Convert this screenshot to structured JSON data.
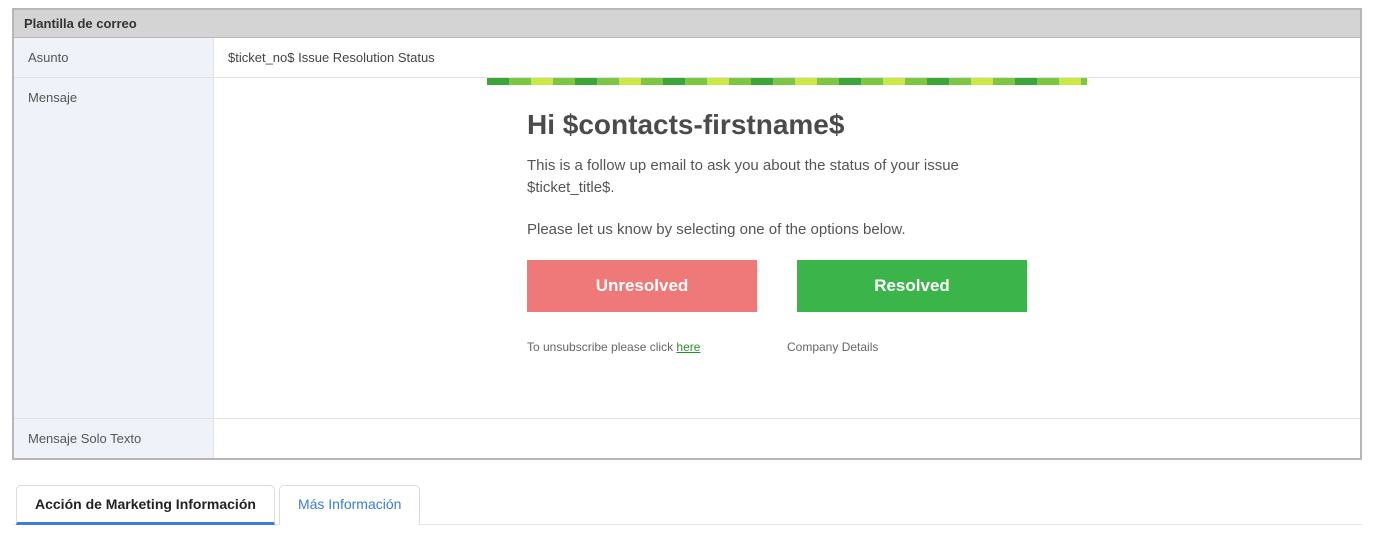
{
  "panel": {
    "title": "Plantilla de correo"
  },
  "fields": {
    "subject_label": "Asunto",
    "subject_value": "$ticket_no$ Issue Resolution Status",
    "message_label": "Mensaje",
    "text_only_label": "Mensaje Solo Texto"
  },
  "email": {
    "greeting": "Hi $contacts-firstname$",
    "p1": "This is a follow up email to ask you about the status of your issue $ticket_title$.",
    "p2": "Please let us know by selecting one of the options below.",
    "btn_unresolved": "Unresolved",
    "btn_resolved": "Resolved",
    "unsubscribe_prefix": "To unsubscribe please click ",
    "unsubscribe_link": "here",
    "company": "Company Details"
  },
  "tabs": {
    "active": "Acción de Marketing Información",
    "inactive": "Más Información"
  }
}
